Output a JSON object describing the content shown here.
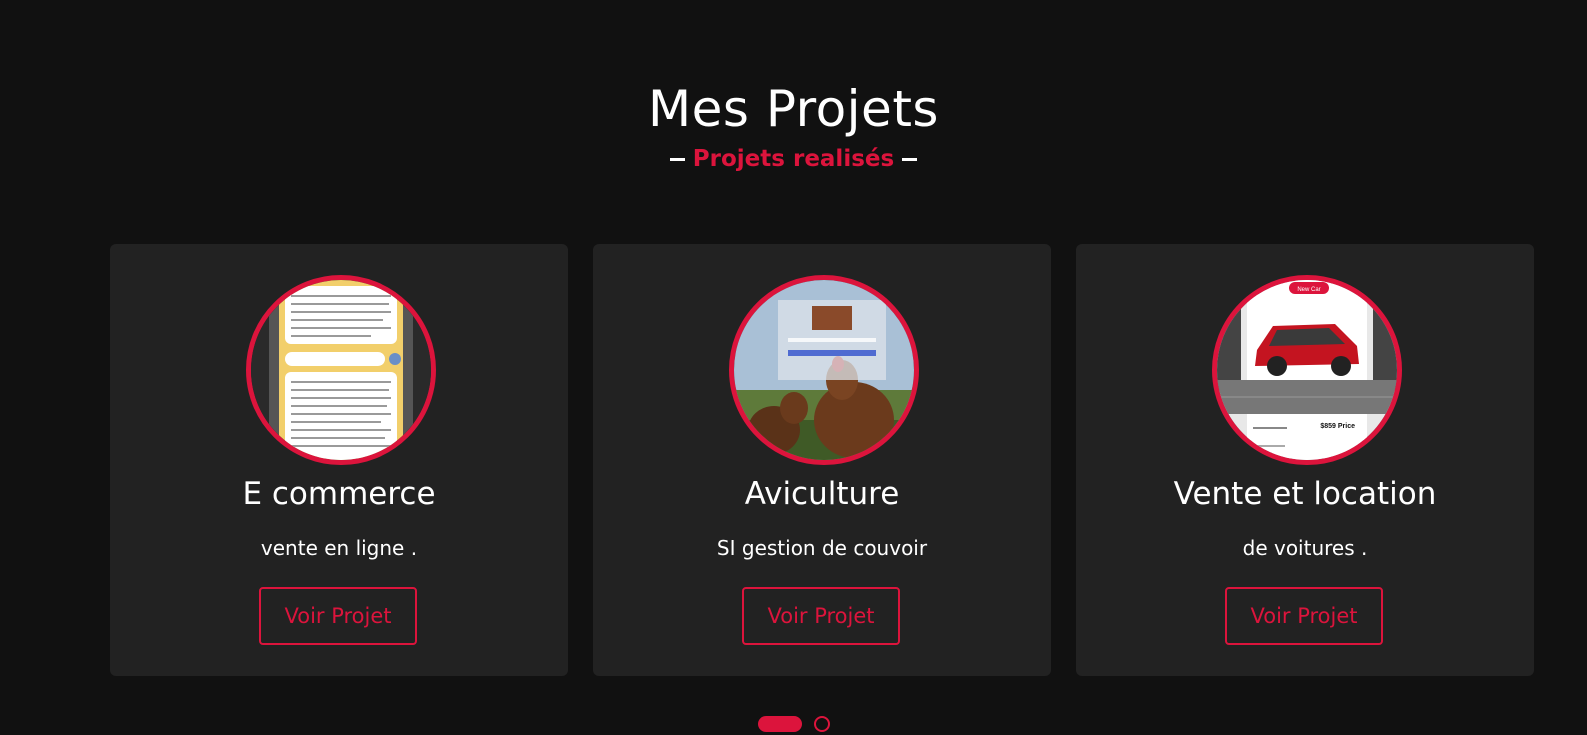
{
  "section": {
    "title": "Mes Projets",
    "subtitle": "Projets realisés",
    "accent_color": "#dc143c",
    "background_color": "#111111",
    "card_color": "#222222"
  },
  "projects": [
    {
      "title": "E commerce",
      "description": "vente en ligne .",
      "button_label": "Voir Projet",
      "image": "chat-app-screenshot"
    },
    {
      "title": "Aviculture",
      "description": "SI gestion de couvoir",
      "button_label": "Voir Projet",
      "image": "chickens-with-login-form"
    },
    {
      "title": "Vente et location",
      "description": "de voitures .",
      "button_label": "Voir Projet",
      "image": "red-suv-car-listing",
      "image_badge": "New Car",
      "image_price": "$859 Price"
    }
  ],
  "pagination": {
    "pages": 2,
    "active_page": 1
  }
}
